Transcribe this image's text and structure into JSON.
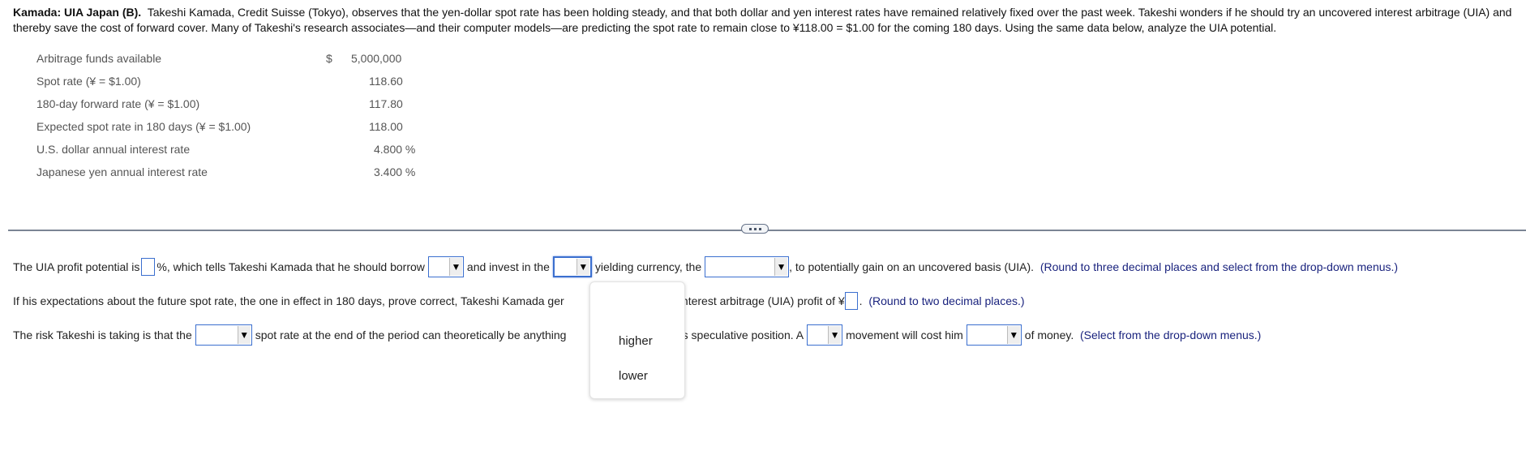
{
  "problem": {
    "title": "Kamada: UIA Japan (B).",
    "text": "Takeshi Kamada, Credit Suisse (Tokyo), observes that the yen-dollar spot rate has been holding steady, and that both dollar and yen interest rates have remained relatively fixed over the past week. Takeshi wonders if he should try an uncovered interest arbitrage (UIA) and thereby save the cost of forward cover. Many of Takeshi's research associates—and their computer models—are predicting the spot rate to remain close to ¥118.00 = $1.00 for the coming 180 days. Using the same data below, analyze the UIA potential."
  },
  "data_table": [
    {
      "label": "Arbitrage funds available",
      "currency": "$",
      "value": "5,000,000"
    },
    {
      "label": "Spot rate (¥ = $1.00)",
      "currency": "",
      "value": "118.60"
    },
    {
      "label": "180-day forward rate (¥ = $1.00)",
      "currency": "",
      "value": "117.80"
    },
    {
      "label": "Expected spot rate in 180 days (¥ = $1.00)",
      "currency": "",
      "value": "118.00"
    },
    {
      "label": "U.S. dollar annual interest rate",
      "currency": "",
      "value": "4.800 %"
    },
    {
      "label": "Japanese yen annual interest rate",
      "currency": "",
      "value": "3.400 %"
    }
  ],
  "questions": {
    "q1": {
      "t1": "The UIA profit potential is",
      "t2": "%, which tells Takeshi Kamada that he should borrow",
      "t3": "and invest in the",
      "t4": "yielding currency, the",
      "t5": ", to potentially gain on an uncovered basis (UIA).",
      "hint": "(Round to three decimal places and select from the drop-down menus.)",
      "profit_value": "",
      "borrow_value": "",
      "invest_value": "",
      "currency_value": ""
    },
    "q2": {
      "t1": "If his expectations about the future spot rate, the one in effect in 180 days, prove correct, Takeshi Kamada ger",
      "t2": "red interest arbitrage (UIA) profit of",
      "yen": "¥",
      "t3": ".",
      "hint": "(Round to two decimal places.)",
      "profit_value": ""
    },
    "q3": {
      "t1": "The risk Takeshi is taking is that the",
      "t2": "spot rate at the end of the period can theoretically be anything",
      "t3": "or his speculative position. A",
      "t4": "movement will cost him",
      "t5": "of money.",
      "hint": "(Select from the drop-down menus.)",
      "spot_value": "",
      "movement_value": "",
      "amount_value": ""
    }
  },
  "dropdown_menu": {
    "options": [
      "",
      "higher",
      "lower"
    ]
  },
  "icons": {
    "dropdown_arrow": "▼",
    "divider_handle": "more-horizontal-icon"
  }
}
